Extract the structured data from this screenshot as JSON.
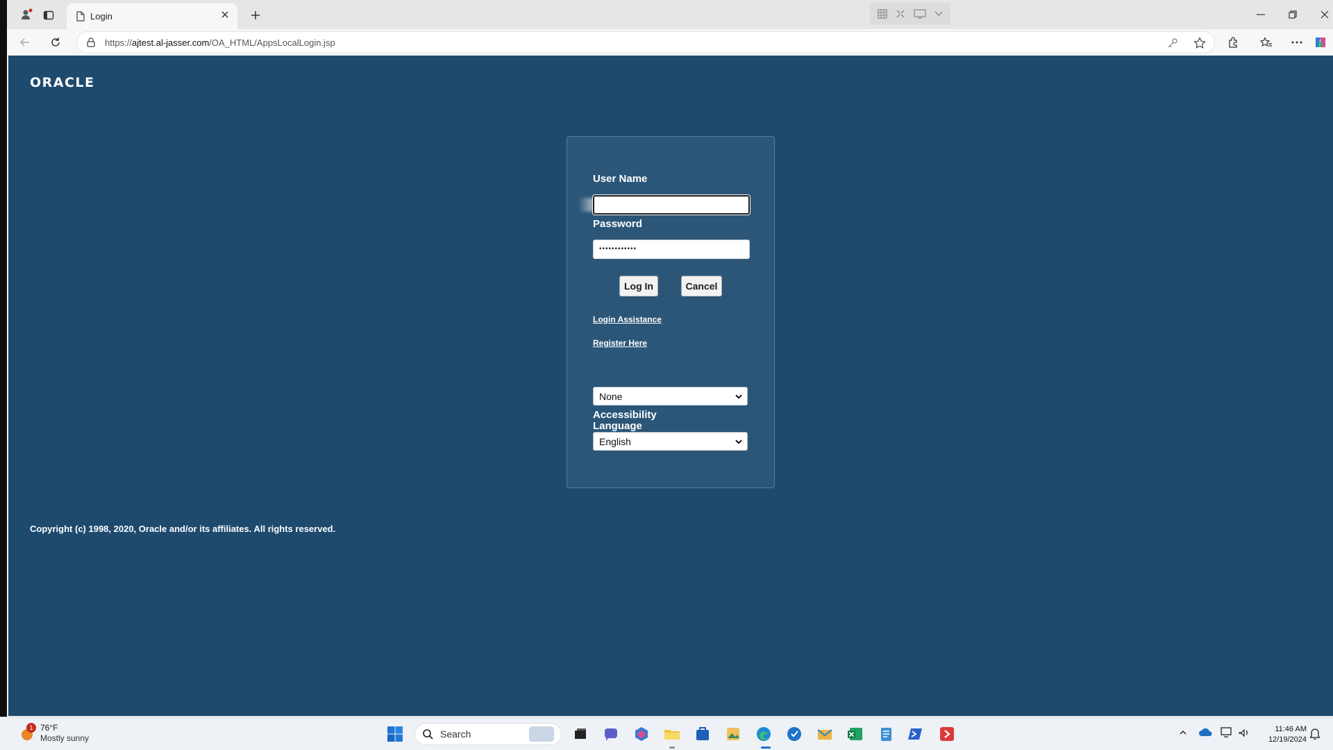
{
  "browser": {
    "tab_title": "Login",
    "url_prefix": "https://",
    "url_host": "ajtest.al-jasser.com",
    "url_path": "/OA_HTML/AppsLocalLogin.jsp"
  },
  "page": {
    "logo_text": "ORACLE",
    "username_label": "User Name",
    "username_value": "",
    "password_label": "Password",
    "password_value": "••••••••••••",
    "login_button": "Log In",
    "cancel_button": "Cancel",
    "login_assistance_link": "Login Assistance",
    "register_link": "Register Here",
    "accessibility_label": "Accessibility",
    "accessibility_value": "None",
    "language_label": "Language",
    "language_value": "English",
    "copyright": "Copyright (c) 1998, 2020, Oracle and/or its affiliates. All rights reserved."
  },
  "taskbar": {
    "weather_temp": "76°F",
    "weather_desc": "Mostly sunny",
    "weather_badge": "1",
    "search_label": "Search",
    "time": "11:46 AM",
    "date": "12/19/2024"
  },
  "colors": {
    "page_background": "#1e4a6e",
    "panel_background": "#2b5678"
  }
}
